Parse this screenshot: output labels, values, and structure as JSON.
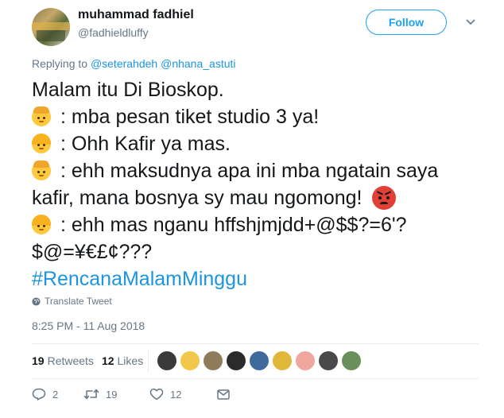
{
  "author": {
    "name": "muhammad fadhiel",
    "handle": "@fadhieldluffy"
  },
  "follow_label": "Follow",
  "replying": {
    "prefix": "Replying to",
    "mentions": [
      "@seterahdeh",
      "@nhana_astuti"
    ]
  },
  "tweet": {
    "line1": "Malam itu Di Bioskop.",
    "line2": ": mba pesan tiket studio 3 ya!",
    "line3": ": Ohh Kafir ya mas.",
    "line4": ": ehh maksudnya apa ini mba ngatain saya",
    "line5": "kafir, mana bosnya sy mau ngomong!",
    "line6": ": ehh mas nganu hffshjmjdd+@$$?=6'?",
    "line7": "$@=¥€£¢???",
    "hashtag": "#RencanaMalamMinggu"
  },
  "translate_label": "Translate Tweet",
  "timestamp": "8:25 PM - 11 Aug 2018",
  "stats": {
    "retweets_count": "19",
    "retweets_label": "Retweets",
    "likes_count": "12",
    "likes_label": "Likes"
  },
  "liker_colors": [
    "#3a3a3a",
    "#f2c84b",
    "#8d7b5c",
    "#2b2b2b",
    "#3f6b9c",
    "#e1b739",
    "#f0a7a0",
    "#4a4a4a",
    "#6b8f5a"
  ],
  "actions": {
    "reply_count": "2",
    "retweet_count": "19",
    "like_count": "12"
  },
  "colors": {
    "accent": "#1da1f2",
    "link": "#1b95e0",
    "muted": "#657786"
  }
}
